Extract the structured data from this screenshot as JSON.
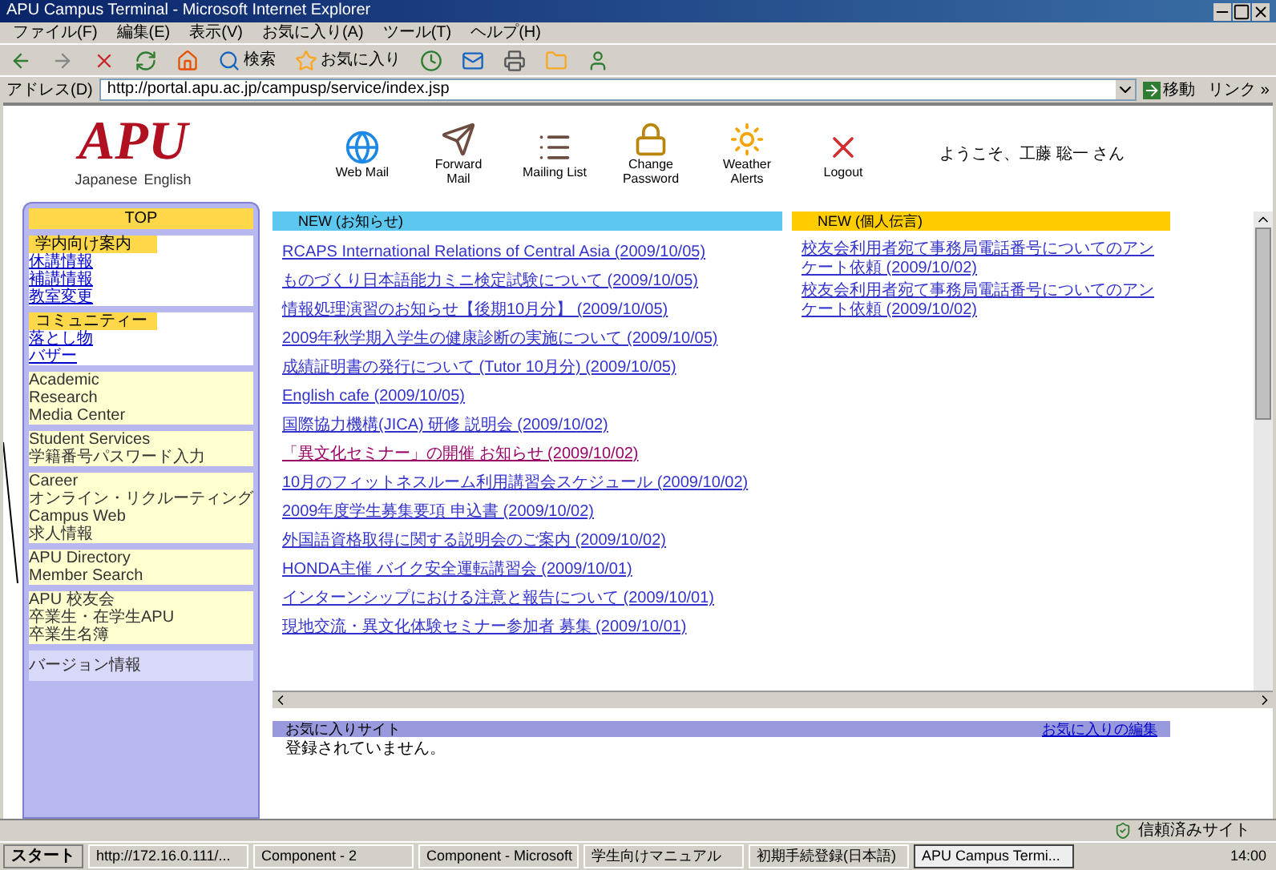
{
  "window": {
    "title": "APU Campus Terminal - Microsoft Internet Explorer"
  },
  "menu": [
    "ファイル(F)",
    "編集(E)",
    "表示(V)",
    "お気に入り(A)",
    "ツール(T)",
    "ヘルプ(H)"
  ],
  "toolbar": [
    {
      "kind": "back"
    },
    {
      "kind": "forward"
    },
    {
      "kind": "stop"
    },
    {
      "kind": "refresh"
    },
    {
      "kind": "home"
    },
    {
      "kind": "search",
      "label": "検索"
    },
    {
      "kind": "favorites",
      "label": "お気に入り"
    },
    {
      "kind": "history"
    },
    {
      "kind": "mail"
    },
    {
      "kind": "print"
    },
    {
      "kind": "folder"
    },
    {
      "kind": "messenger"
    }
  ],
  "address": {
    "label": "アドレス(D)",
    "value": "http://portal.apu.ac.jp/campusp/service/index.jsp",
    "go": "移動",
    "links": "リンク »"
  },
  "header": {
    "logo": "APU",
    "languages": [
      "Japanese",
      "English"
    ],
    "nav": [
      {
        "kind": "webmail",
        "label": "Web Mail"
      },
      {
        "kind": "forward",
        "label": "Forward Mail"
      },
      {
        "kind": "list",
        "label": "Mailing List"
      },
      {
        "kind": "password",
        "label": "Change Password"
      },
      {
        "kind": "weather",
        "label": "Weather Alerts"
      },
      {
        "kind": "logout",
        "label": "Logout"
      }
    ],
    "greeting": "ようこそ、工藤 聡一 さん"
  },
  "sidebar": {
    "top": "TOP",
    "groups": [
      {
        "title": "学内向け案内",
        "items": [
          "休講情報",
          "補講情報",
          "教室変更"
        ]
      },
      {
        "title": "コミュニティー",
        "items": [
          "落とし物",
          "バザー"
        ]
      },
      {
        "items": [
          "Academic",
          "Research",
          "Media Center"
        ]
      },
      {
        "items": [
          "Student Services",
          "学籍番号パスワード入力"
        ]
      },
      {
        "items": [
          "Career",
          "オンライン・リクルーティング",
          "Campus Web",
          "求人情報"
        ]
      },
      {
        "items": [
          "APU Directory",
          "Member Search"
        ]
      },
      {
        "items": [
          "APU 校友会",
          "卒業生・在学生APU",
          "卒業生名簿"
        ]
      }
    ],
    "version": "バージョン情報"
  },
  "news": {
    "title": "NEW (お知らせ)",
    "items": [
      {
        "text": "RCAPS International Relations of Central Asia (2009/10/05)",
        "visited": false
      },
      {
        "text": "ものづくり日本語能力ミニ検定試験について (2009/10/05)",
        "visited": false
      },
      {
        "text": "情報処理演習のお知らせ【後期10月分】 (2009/10/05)",
        "visited": false
      },
      {
        "text": "2009年秋学期入学生の健康診断の実施について (2009/10/05)",
        "visited": false
      },
      {
        "text": "成績証明書の発行について (Tutor 10月分) (2009/10/05)",
        "visited": false
      },
      {
        "text": "English cafe (2009/10/05)",
        "visited": false
      },
      {
        "text": "国際協力機構(JICA) 研修 説明会 (2009/10/02)",
        "visited": false
      },
      {
        "text": "「異文化セミナー」の開催 お知らせ (2009/10/02)",
        "visited": true
      },
      {
        "text": "10月のフィットネスルーム利用講習会スケジュール (2009/10/02)",
        "visited": false
      },
      {
        "text": "2009年度学生募集要項 申込書 (2009/10/02)",
        "visited": false
      },
      {
        "text": "外国語資格取得に関する説明会のご案内 (2009/10/02)",
        "visited": false
      },
      {
        "text": "HONDA主催 バイク安全運転講習会 (2009/10/01)",
        "visited": false
      },
      {
        "text": "インターンシップにおける注意と報告について (2009/10/01)",
        "visited": false
      },
      {
        "text": "現地交流・異文化体験セミナー参加者 募集 (2009/10/01)",
        "visited": false
      }
    ]
  },
  "personal": {
    "title": "NEW (個人伝言)",
    "items": [
      "校友会利用者宛て事務局電話番号についてのアンケート依頼 (2009/10/02)",
      "校友会利用者宛て事務局電話番号についてのアンケート依頼 (2009/10/02)"
    ]
  },
  "favorites": {
    "title": "お気に入りサイト",
    "edit": "お気に入りの編集",
    "empty": "登録されていません。"
  },
  "status": {
    "zone": "信頼済みサイト"
  },
  "taskbar": {
    "start": "スタート",
    "tasks": [
      {
        "label": "http://172.16.0.111/...",
        "selected": false
      },
      {
        "label": "Component - 2",
        "selected": false
      },
      {
        "label": "Component - Microsoft",
        "selected": false
      },
      {
        "label": "学生向けマニュアル",
        "selected": false
      },
      {
        "label": "初期手続登録(日本語)",
        "selected": false
      },
      {
        "label": "APU Campus Termi...",
        "selected": true
      }
    ],
    "clock": "14:00"
  }
}
